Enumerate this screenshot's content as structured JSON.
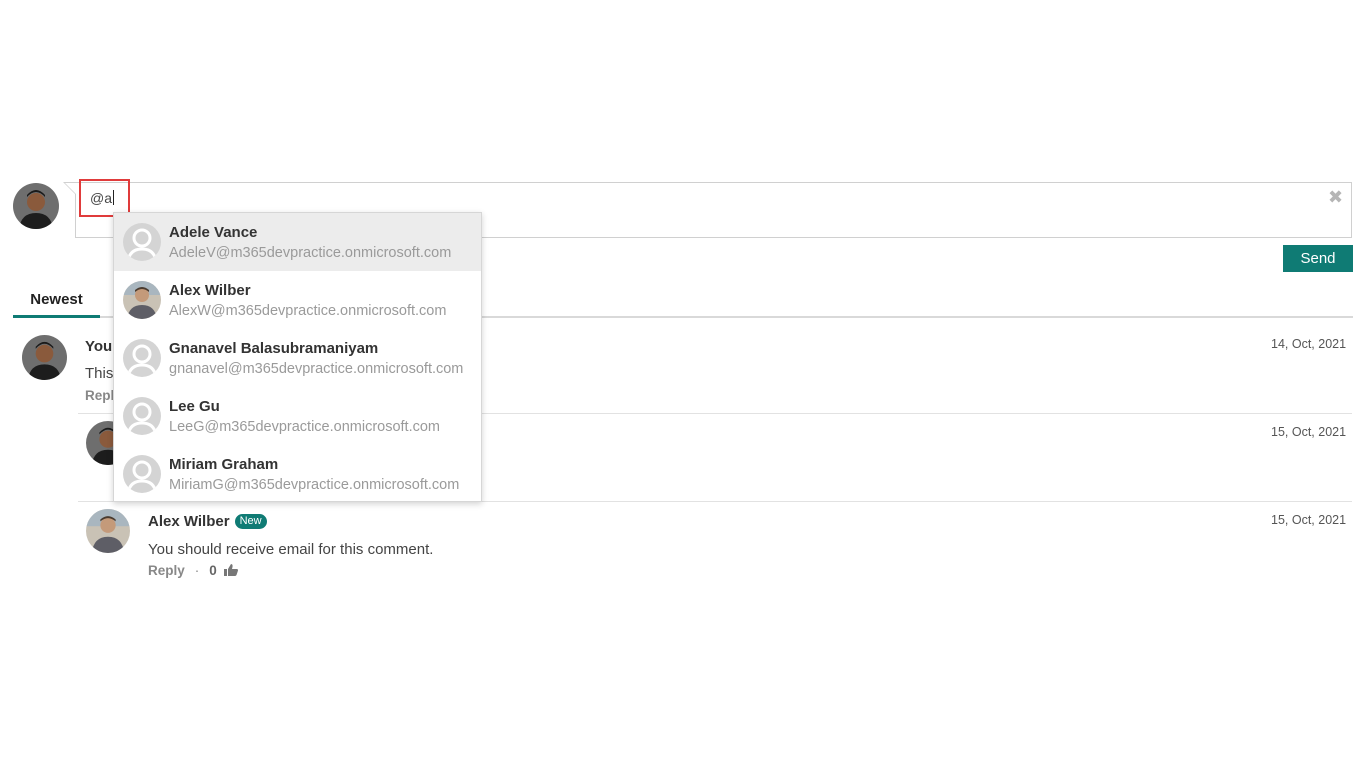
{
  "composer": {
    "input_value": "@a",
    "send_label": "Send",
    "clear_icon": "✖"
  },
  "tabs": [
    {
      "label": "Newest",
      "active": true
    }
  ],
  "comments": [
    {
      "name": "You",
      "text": "This",
      "date": "14, Oct, 2021",
      "reply": "Repl"
    },
    {
      "date": "15, Oct, 2021"
    },
    {
      "name": "Alex Wilber",
      "badge": "New",
      "text": "You should receive email for this comment.",
      "date": "15, Oct, 2021",
      "reply": "Reply",
      "separator": "·",
      "likes": "0"
    }
  ],
  "mention_dropdown": {
    "items": [
      {
        "name": "Adele Vance",
        "email": "AdeleV@m365devpractice.onmicrosoft.com",
        "avatar": "default-avatar",
        "selected": true
      },
      {
        "name": "Alex Wilber",
        "email": "AlexW@m365devpractice.onmicrosoft.com",
        "avatar": "photo-avatar"
      },
      {
        "name": "Gnanavel Balasubramaniyam",
        "email": "gnanavel@m365devpractice.onmicrosoft.com",
        "avatar": "default-avatar"
      },
      {
        "name": "Lee Gu",
        "email": "LeeG@m365devpractice.onmicrosoft.com",
        "avatar": "default-avatar"
      },
      {
        "name": "Miriam Graham",
        "email": "MiriamG@m365devpractice.onmicrosoft.com",
        "avatar": "default-avatar"
      }
    ]
  },
  "colors": {
    "accent": "#0f7b74",
    "highlight": "#e03b3b"
  },
  "icons": {
    "like": "thumbs-up-icon",
    "clear": "close-icon"
  }
}
